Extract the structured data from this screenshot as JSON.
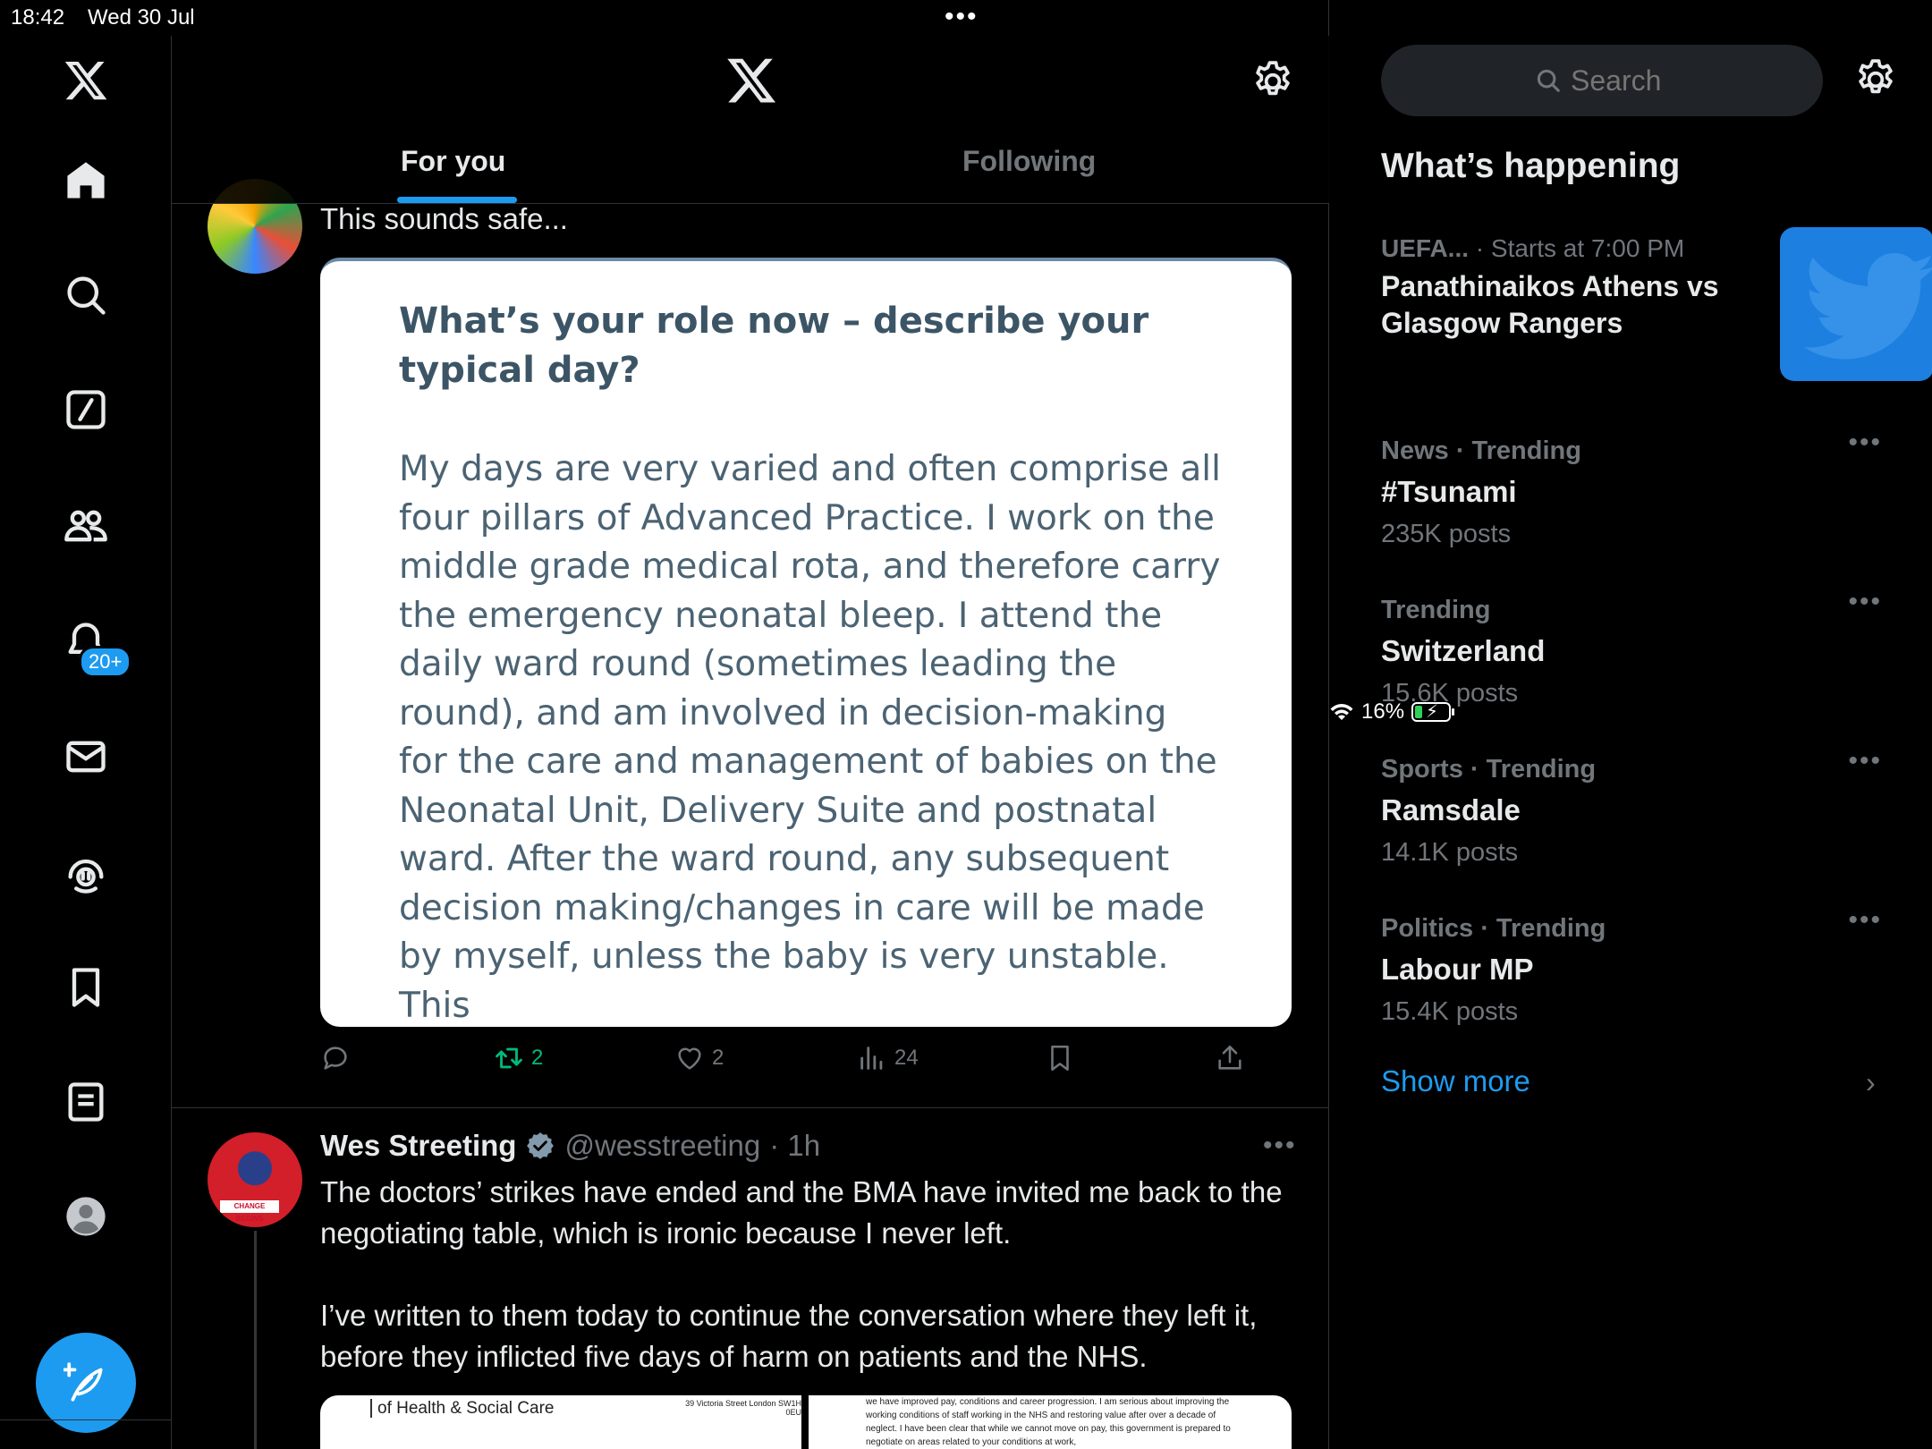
{
  "status_bar": {
    "time": "18:42",
    "date": "Wed 30 Jul",
    "battery_percent": "16%",
    "battery_level": 0.16,
    "charging": true
  },
  "left_nav": {
    "items": [
      "x-logo",
      "home",
      "search",
      "grok",
      "communities",
      "notifications",
      "messages",
      "spaces",
      "bookmarks",
      "lists",
      "profile"
    ],
    "notifications_badge": "20+",
    "compose_icon": "compose-plus-feather-icon"
  },
  "header": {
    "tabs": [
      {
        "label": "For you",
        "active": true
      },
      {
        "label": "Following",
        "active": false
      }
    ]
  },
  "tweet1": {
    "text": "This sounds safe...",
    "quote": {
      "title": "What’s your role now – describe your typical day?",
      "body": "My days are very varied and often comprise all four pillars of Advanced Practice.  I work on the middle grade medical rota, and therefore carry the emergency neonatal bleep.  I attend the daily ward round (sometimes leading the round), and am involved in decision-making for the care and management of babies on the Neonatal Unit, Delivery Suite and postnatal ward.  After the ward round, any subsequent decision making/changes in care will be made by myself, unless the baby is very unstable.  This"
    },
    "actions": {
      "reply": "",
      "retweets": "2",
      "likes": "2",
      "views": "24"
    }
  },
  "tweet2": {
    "name": "Wes Streeting",
    "handle": "@wesstreeting",
    "time": "· 1h",
    "paragraphs": [
      "The doctors’ strikes have ended and the BMA have invited me back to the negotiating table, which is ironic because I never left.",
      "I’ve written to them today to continue the conversation where they left it, before they inflicted five days of harm on patients and the NHS."
    ],
    "media1_org": "of Health & Social Care",
    "media1_address": "39 Victoria Street London SW1H 0EU",
    "media2_text": "we have improved pay, conditions and career progression. I am serious about improving the working conditions of staff working in the NHS and restoring value after over a decade of neglect. I have been clear that while we cannot move on pay, this government is prepared to negotiate on areas related to your conditions at work,",
    "avatar_banner": "CHANGE BEGINS"
  },
  "right_panel": {
    "search_placeholder": "Search",
    "whats_happening": "What’s happening",
    "event": {
      "category": "UEFA...",
      "meta": "· Starts at 7:00 PM",
      "title": "Panathinaikos Athens vs Glasgow Rangers"
    },
    "trends": [
      {
        "category": "News · Trending",
        "name": "#Tsunami",
        "count": "235K posts"
      },
      {
        "category": "Trending",
        "name": "Switzerland",
        "count": "15.6K posts"
      },
      {
        "category": "Sports · Trending",
        "name": "Ramsdale",
        "count": "14.1K posts"
      },
      {
        "category": "Politics · Trending",
        "name": "Labour MP",
        "count": "15.4K posts"
      }
    ],
    "show_more": "Show more"
  },
  "colors": {
    "accent": "#1d9bf0",
    "retweet_green": "#00ba7c",
    "muted": "#71767b",
    "border": "#2f3336"
  }
}
